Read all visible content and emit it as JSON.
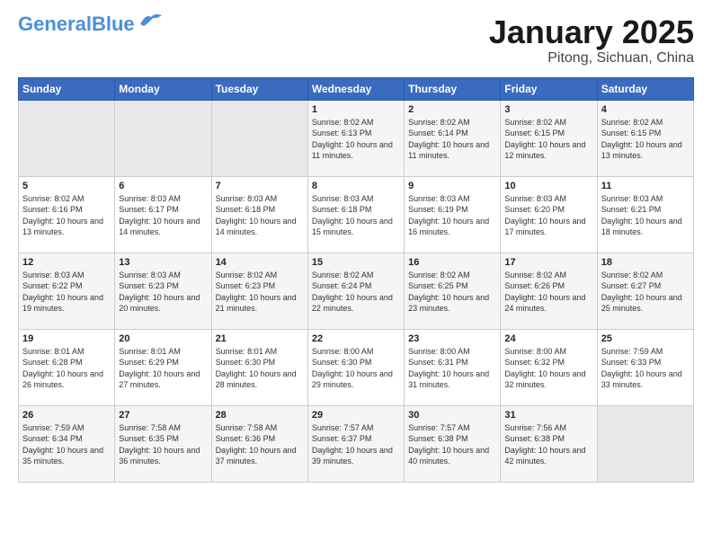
{
  "header": {
    "logo_line1": "General",
    "logo_line2": "Blue",
    "title": "January 2025",
    "subtitle": "Pitong, Sichuan, China"
  },
  "days_of_week": [
    "Sunday",
    "Monday",
    "Tuesday",
    "Wednesday",
    "Thursday",
    "Friday",
    "Saturday"
  ],
  "weeks": [
    [
      {
        "num": "",
        "sunrise": "",
        "sunset": "",
        "daylight": "",
        "empty": true
      },
      {
        "num": "",
        "sunrise": "",
        "sunset": "",
        "daylight": "",
        "empty": true
      },
      {
        "num": "",
        "sunrise": "",
        "sunset": "",
        "daylight": "",
        "empty": true
      },
      {
        "num": "1",
        "sunrise": "Sunrise: 8:02 AM",
        "sunset": "Sunset: 6:13 PM",
        "daylight": "Daylight: 10 hours and 11 minutes."
      },
      {
        "num": "2",
        "sunrise": "Sunrise: 8:02 AM",
        "sunset": "Sunset: 6:14 PM",
        "daylight": "Daylight: 10 hours and 11 minutes."
      },
      {
        "num": "3",
        "sunrise": "Sunrise: 8:02 AM",
        "sunset": "Sunset: 6:15 PM",
        "daylight": "Daylight: 10 hours and 12 minutes."
      },
      {
        "num": "4",
        "sunrise": "Sunrise: 8:02 AM",
        "sunset": "Sunset: 6:15 PM",
        "daylight": "Daylight: 10 hours and 13 minutes."
      }
    ],
    [
      {
        "num": "5",
        "sunrise": "Sunrise: 8:02 AM",
        "sunset": "Sunset: 6:16 PM",
        "daylight": "Daylight: 10 hours and 13 minutes."
      },
      {
        "num": "6",
        "sunrise": "Sunrise: 8:03 AM",
        "sunset": "Sunset: 6:17 PM",
        "daylight": "Daylight: 10 hours and 14 minutes."
      },
      {
        "num": "7",
        "sunrise": "Sunrise: 8:03 AM",
        "sunset": "Sunset: 6:18 PM",
        "daylight": "Daylight: 10 hours and 14 minutes."
      },
      {
        "num": "8",
        "sunrise": "Sunrise: 8:03 AM",
        "sunset": "Sunset: 6:18 PM",
        "daylight": "Daylight: 10 hours and 15 minutes."
      },
      {
        "num": "9",
        "sunrise": "Sunrise: 8:03 AM",
        "sunset": "Sunset: 6:19 PM",
        "daylight": "Daylight: 10 hours and 16 minutes."
      },
      {
        "num": "10",
        "sunrise": "Sunrise: 8:03 AM",
        "sunset": "Sunset: 6:20 PM",
        "daylight": "Daylight: 10 hours and 17 minutes."
      },
      {
        "num": "11",
        "sunrise": "Sunrise: 8:03 AM",
        "sunset": "Sunset: 6:21 PM",
        "daylight": "Daylight: 10 hours and 18 minutes."
      }
    ],
    [
      {
        "num": "12",
        "sunrise": "Sunrise: 8:03 AM",
        "sunset": "Sunset: 6:22 PM",
        "daylight": "Daylight: 10 hours and 19 minutes."
      },
      {
        "num": "13",
        "sunrise": "Sunrise: 8:03 AM",
        "sunset": "Sunset: 6:23 PM",
        "daylight": "Daylight: 10 hours and 20 minutes."
      },
      {
        "num": "14",
        "sunrise": "Sunrise: 8:02 AM",
        "sunset": "Sunset: 6:23 PM",
        "daylight": "Daylight: 10 hours and 21 minutes."
      },
      {
        "num": "15",
        "sunrise": "Sunrise: 8:02 AM",
        "sunset": "Sunset: 6:24 PM",
        "daylight": "Daylight: 10 hours and 22 minutes."
      },
      {
        "num": "16",
        "sunrise": "Sunrise: 8:02 AM",
        "sunset": "Sunset: 6:25 PM",
        "daylight": "Daylight: 10 hours and 23 minutes."
      },
      {
        "num": "17",
        "sunrise": "Sunrise: 8:02 AM",
        "sunset": "Sunset: 6:26 PM",
        "daylight": "Daylight: 10 hours and 24 minutes."
      },
      {
        "num": "18",
        "sunrise": "Sunrise: 8:02 AM",
        "sunset": "Sunset: 6:27 PM",
        "daylight": "Daylight: 10 hours and 25 minutes."
      }
    ],
    [
      {
        "num": "19",
        "sunrise": "Sunrise: 8:01 AM",
        "sunset": "Sunset: 6:28 PM",
        "daylight": "Daylight: 10 hours and 26 minutes."
      },
      {
        "num": "20",
        "sunrise": "Sunrise: 8:01 AM",
        "sunset": "Sunset: 6:29 PM",
        "daylight": "Daylight: 10 hours and 27 minutes."
      },
      {
        "num": "21",
        "sunrise": "Sunrise: 8:01 AM",
        "sunset": "Sunset: 6:30 PM",
        "daylight": "Daylight: 10 hours and 28 minutes."
      },
      {
        "num": "22",
        "sunrise": "Sunrise: 8:00 AM",
        "sunset": "Sunset: 6:30 PM",
        "daylight": "Daylight: 10 hours and 29 minutes."
      },
      {
        "num": "23",
        "sunrise": "Sunrise: 8:00 AM",
        "sunset": "Sunset: 6:31 PM",
        "daylight": "Daylight: 10 hours and 31 minutes."
      },
      {
        "num": "24",
        "sunrise": "Sunrise: 8:00 AM",
        "sunset": "Sunset: 6:32 PM",
        "daylight": "Daylight: 10 hours and 32 minutes."
      },
      {
        "num": "25",
        "sunrise": "Sunrise: 7:59 AM",
        "sunset": "Sunset: 6:33 PM",
        "daylight": "Daylight: 10 hours and 33 minutes."
      }
    ],
    [
      {
        "num": "26",
        "sunrise": "Sunrise: 7:59 AM",
        "sunset": "Sunset: 6:34 PM",
        "daylight": "Daylight: 10 hours and 35 minutes."
      },
      {
        "num": "27",
        "sunrise": "Sunrise: 7:58 AM",
        "sunset": "Sunset: 6:35 PM",
        "daylight": "Daylight: 10 hours and 36 minutes."
      },
      {
        "num": "28",
        "sunrise": "Sunrise: 7:58 AM",
        "sunset": "Sunset: 6:36 PM",
        "daylight": "Daylight: 10 hours and 37 minutes."
      },
      {
        "num": "29",
        "sunrise": "Sunrise: 7:57 AM",
        "sunset": "Sunset: 6:37 PM",
        "daylight": "Daylight: 10 hours and 39 minutes."
      },
      {
        "num": "30",
        "sunrise": "Sunrise: 7:57 AM",
        "sunset": "Sunset: 6:38 PM",
        "daylight": "Daylight: 10 hours and 40 minutes."
      },
      {
        "num": "31",
        "sunrise": "Sunrise: 7:56 AM",
        "sunset": "Sunset: 6:38 PM",
        "daylight": "Daylight: 10 hours and 42 minutes."
      },
      {
        "num": "",
        "sunrise": "",
        "sunset": "",
        "daylight": "",
        "empty": true
      }
    ]
  ]
}
